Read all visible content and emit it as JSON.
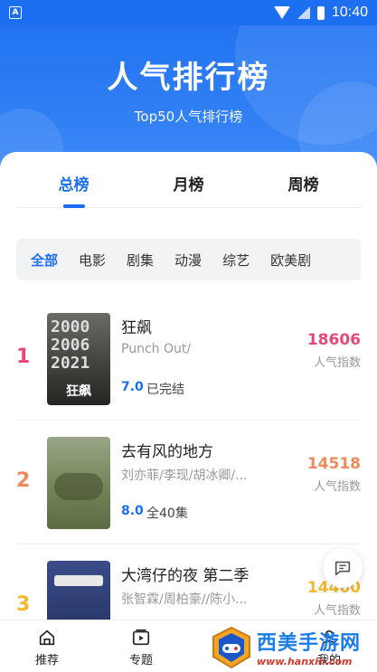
{
  "status_bar": {
    "time": "10:40",
    "app_badge": "A"
  },
  "header": {
    "title": "人气排行榜",
    "subtitle": "Top50人气排行榜"
  },
  "tabs": [
    {
      "label": "总榜",
      "active": true
    },
    {
      "label": "月榜",
      "active": false
    },
    {
      "label": "周榜",
      "active": false
    }
  ],
  "filters": [
    {
      "label": "全部",
      "active": true
    },
    {
      "label": "电影",
      "active": false
    },
    {
      "label": "剧集",
      "active": false
    },
    {
      "label": "动漫",
      "active": false
    },
    {
      "label": "综艺",
      "active": false
    },
    {
      "label": "欧美剧",
      "active": false
    }
  ],
  "ranking": [
    {
      "rank": "1",
      "rank_color": "#e5487a",
      "title": "狂飙",
      "subtitle": "Punch Out/",
      "score": "7.0",
      "status": "已完结",
      "hot_value": "18606",
      "hot_color": "#e5487a",
      "hot_label": "人气指数",
      "poster_text": "狂飙",
      "poster_color": "#5a5a58"
    },
    {
      "rank": "2",
      "rank_color": "#f08a5d",
      "title": "去有风的地方",
      "subtitle": "刘亦菲/李现/胡冰卿/...",
      "score": "8.0",
      "status": "全40集",
      "hot_value": "14518",
      "hot_color": "#f08a5d",
      "hot_label": "人气指数",
      "poster_text": "",
      "poster_color": "#6b7f58"
    },
    {
      "rank": "3",
      "rank_color": "#f2b92f",
      "title": "大湾仔的夜 第二季",
      "subtitle": "张智霖/周柏豪//陈小...",
      "score": "",
      "status": "",
      "hot_value": "14460",
      "hot_color": "#f2b92f",
      "hot_label": "人气指数",
      "poster_text": "",
      "poster_color": "#2b3b6e"
    }
  ],
  "bottom_nav": [
    {
      "label": "推荐",
      "icon": "home-icon"
    },
    {
      "label": "专题",
      "icon": "play-box-icon"
    },
    {
      "label": "",
      "icon": ""
    },
    {
      "label": "我的",
      "icon": "user-icon"
    }
  ],
  "watermark": {
    "name": "西美手游网",
    "url": "www.hanxin.com"
  }
}
